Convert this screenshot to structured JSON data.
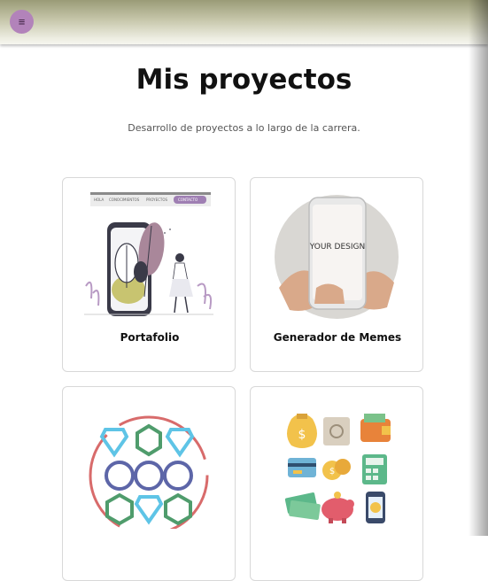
{
  "header": {
    "menu_icon": "hamburger-icon",
    "menu_glyph": "≡"
  },
  "page": {
    "title": "Mis proyectos",
    "subtitle": "Desarrollo de proyectos a lo largo de la carrera."
  },
  "projects": [
    {
      "title": "Portafolio",
      "image_nav_items": [
        "HOLA",
        "CONOCIMIENTOS",
        "PROYECTOS",
        "CONTACTO"
      ]
    },
    {
      "title": "Generador de Memes",
      "image_text": "YOUR DESIGN"
    },
    {
      "title": ""
    },
    {
      "title": ""
    }
  ],
  "colors": {
    "header": "#c7c7ab",
    "menu_button": "#b283ba",
    "card_border": "#d8d8d8",
    "accent_purple": "#9f7fb3"
  }
}
